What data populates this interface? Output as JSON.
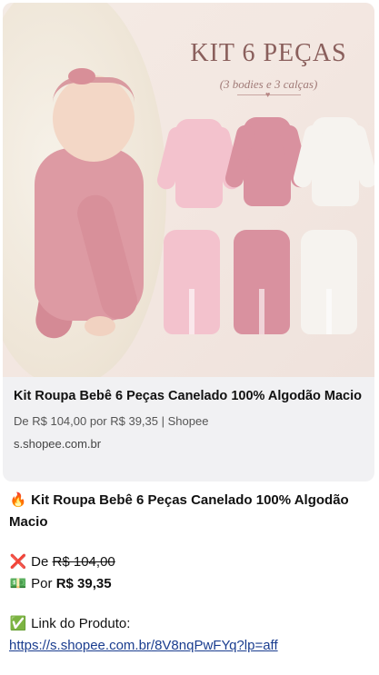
{
  "preview": {
    "image_heading": "KIT 6 PEÇAS",
    "image_subheading": "(3 bodies e 3 calças)",
    "colors": {
      "pink_light": "#f3c2cd",
      "pink_medium": "#d9919f",
      "white": "#f6f3ef"
    },
    "title": "Kit Roupa Bebê 6 Peças Canelado 100% Algodão Macio",
    "meta": "De R$ 104,00 por R$ 39,35 | Shopee",
    "domain": "s.shopee.com.br"
  },
  "message": {
    "headline_icon": "🔥",
    "headline": "Kit Roupa Bebê 6 Peças Canelado 100% Algodão Macio",
    "old_price_icon": "❌",
    "old_price_prefix": "De",
    "old_price": "R$ 104,00",
    "new_price_icon": "💵",
    "new_price_prefix": "Por",
    "new_price": "R$ 39,35",
    "link_icon": "✅",
    "link_label": "Link do Produto:",
    "link_url": "https://s.shopee.com.br/8V8nqPwFYq?lp=aff"
  }
}
